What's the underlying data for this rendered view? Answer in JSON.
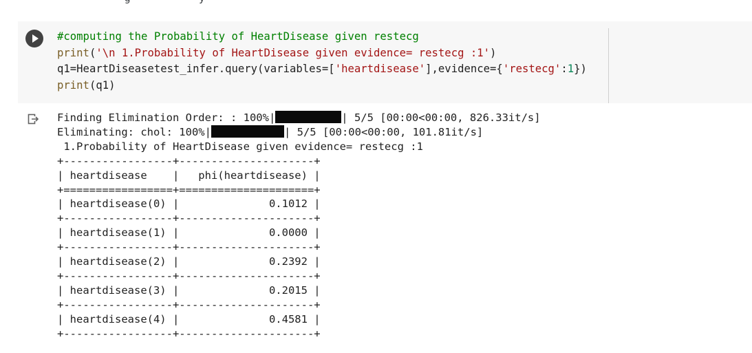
{
  "top_partial_text": "                    g           y",
  "run_button": {
    "icon": "play-icon"
  },
  "code": {
    "line1": "#computing the Probability of HeartDisease given restecg",
    "line2": {
      "func": "print",
      "open": "(",
      "string": "'\\n 1.Probability of HeartDisease given evidence= restecg :1'",
      "close": ")"
    },
    "line3": {
      "prefix": "q1=HeartDiseasetest_infer.query(variables=[",
      "var_string": "'heartdisease'",
      "middle": "],evidence={",
      "key_string": "'restecg'",
      "colon": ":",
      "value": "1",
      "suffix": "})"
    },
    "line4": {
      "func": "print",
      "args": "(q1)"
    }
  },
  "output": {
    "icon": "output-arrow-icon",
    "progress1": {
      "label": "Finding Elimination Order: : 100%|",
      "stats": "| 5/5 [00:00<00:00, 826.33it/s]"
    },
    "progress2": {
      "label": "Eliminating: chol: 100%|",
      "stats": "| 5/5 [00:00<00:00, 101.81it/s]"
    },
    "result_heading": " 1.Probability of HeartDisease given evidence= restecg :1",
    "table": {
      "border_line": "+-----------------+---------------------+",
      "header_separator": "+=================+=====================+",
      "header_row": "| heartdisease    |   phi(heartdisease) |",
      "rows": [
        "| heartdisease(0) |              0.1012 |",
        "| heartdisease(1) |              0.0000 |",
        "| heartdisease(2) |              0.2392 |",
        "| heartdisease(3) |              0.2015 |",
        "| heartdisease(4) |              0.4581 |"
      ]
    }
  }
}
